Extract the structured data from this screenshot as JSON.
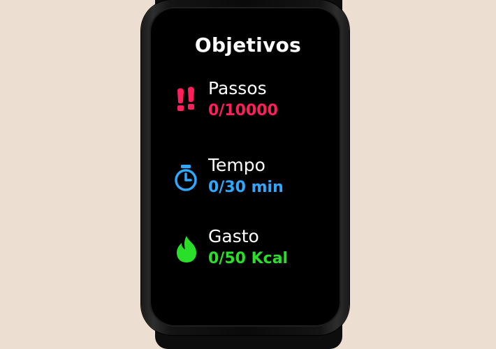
{
  "screen": {
    "title": "Objetivos"
  },
  "goals": [
    {
      "label": "Passos",
      "value": "0/10000",
      "icon": "footprints-icon",
      "color": "#ff1f5a"
    },
    {
      "label": "Tempo",
      "value": "0/30 min",
      "icon": "stopwatch-icon",
      "color": "#2fa8ff"
    },
    {
      "label": "Gasto",
      "value": "0/50 Kcal",
      "icon": "flame-icon",
      "color": "#2adf2a"
    }
  ]
}
